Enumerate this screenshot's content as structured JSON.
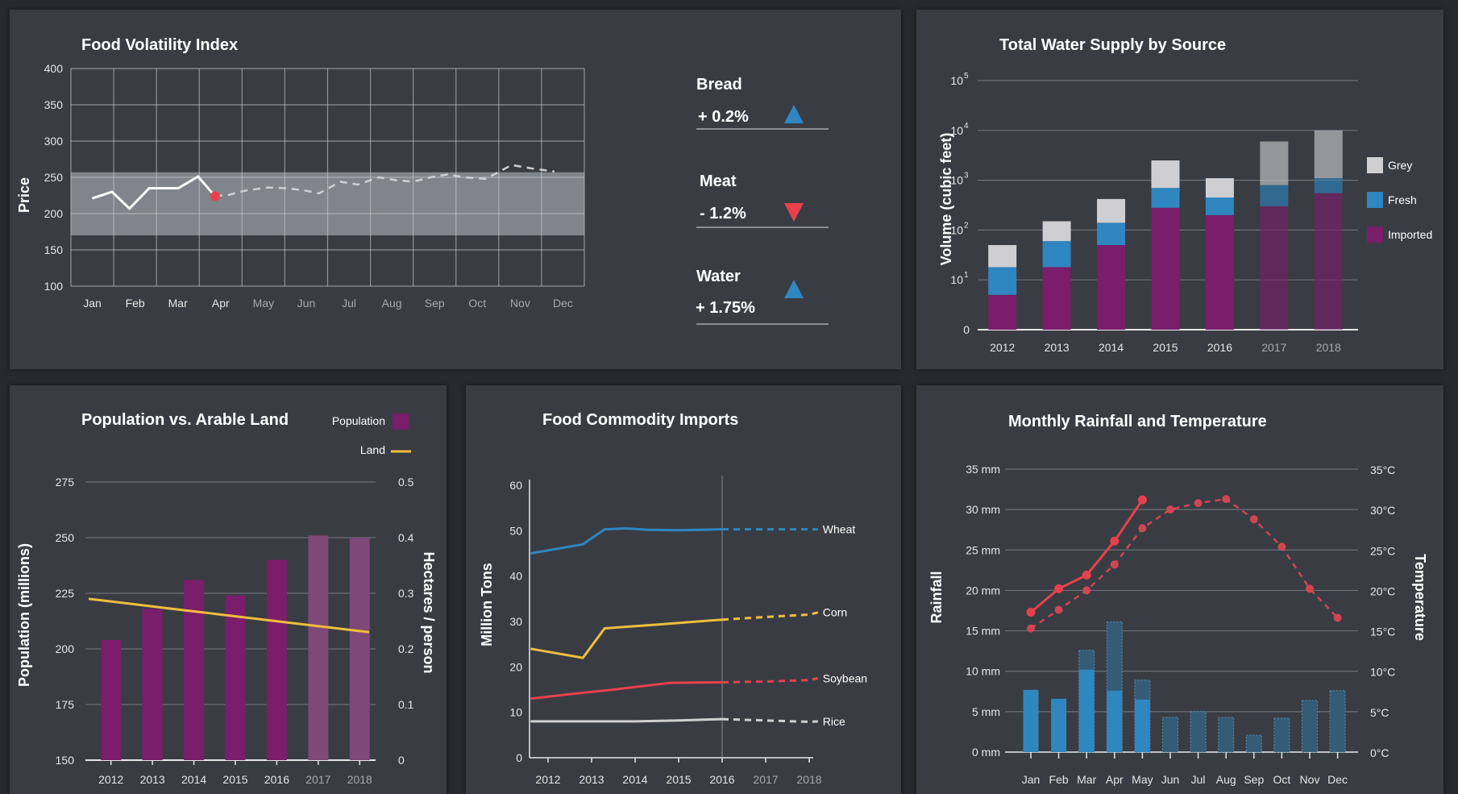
{
  "colors": {
    "grid": "#6d7076",
    "purple": "#7a1d6b",
    "purple_dim": "#7e4877",
    "blue": "#2f86c1",
    "grey_bar": "#cfcfd1",
    "band": "#8d9099",
    "red": "#e8414c",
    "red_dots": "#cf4652",
    "yellow": "#f0bd3f",
    "line_white": "#ffffff",
    "line_grey": "#d0d0d0",
    "rain_bar": "#2f87bf",
    "rain_bar_proj": "#355c75"
  },
  "kpis": [
    {
      "name": "Bread",
      "value": "+ 0.2%",
      "trend": "up",
      "trend_color": "#2f86c1"
    },
    {
      "name": "Meat",
      "value": "- 1.2%",
      "trend": "down",
      "trend_color": "#e8414c"
    },
    {
      "name": "Water",
      "value": "+ 1.75%",
      "trend": "up",
      "trend_color": "#2f86c1"
    }
  ],
  "chart_data": [
    {
      "id": "food",
      "type": "line",
      "title": "Food Volatility Index",
      "ylabel": "Price",
      "xlabel": "",
      "ylim": [
        100,
        400
      ],
      "yticks": [
        100,
        150,
        200,
        250,
        300,
        350,
        400
      ],
      "categories": [
        "Jan",
        "Feb",
        "Mar",
        "Apr",
        "May",
        "Jun",
        "Jul",
        "Aug",
        "Sep",
        "Oct",
        "Nov",
        "Dec"
      ],
      "band": [
        170,
        257
      ],
      "series": [
        {
          "kind": "actual",
          "x": [
            0.5,
            0.96,
            1.37,
            1.83,
            2.51,
            2.97,
            3.37
          ],
          "y": [
            221,
            230,
            207,
            235,
            235,
            251,
            224
          ]
        },
        {
          "kind": "forecast",
          "x": [
            3.37,
            3.7,
            4.1,
            4.6,
            5.05,
            5.45,
            5.8,
            6.3,
            6.7,
            7.2,
            7.6,
            8.0,
            8.4,
            8.8,
            9.2,
            9.7,
            10.3,
            10.8,
            11.3
          ],
          "y": [
            224,
            226,
            232,
            236,
            235,
            232,
            228,
            244,
            240,
            250,
            246,
            244,
            250,
            254,
            250,
            248,
            267,
            262,
            258
          ]
        }
      ],
      "marker": {
        "x": 3.37,
        "y": 224
      }
    },
    {
      "id": "water",
      "type": "bar",
      "title": "Total Water Supply by Source",
      "ylabel": "Volume (cubic feet)",
      "xlabel": "",
      "scale": "log",
      "yticks": [
        {
          "label": "0",
          "exp": null
        },
        {
          "label": "10",
          "exp": "1"
        },
        {
          "label": "10",
          "exp": "2"
        },
        {
          "label": "10",
          "exp": "3"
        },
        {
          "label": "10",
          "exp": "4"
        },
        {
          "label": "10",
          "exp": "5"
        }
      ],
      "categories": [
        "2012",
        "2013",
        "2014",
        "2015",
        "2016",
        "2017",
        "2018"
      ],
      "projected_from": 5,
      "series": [
        {
          "name": "Imported",
          "values": [
            5,
            18,
            50,
            280,
            200,
            300,
            550
          ]
        },
        {
          "name": "Fresh",
          "values": [
            18,
            60,
            140,
            700,
            450,
            800,
            1100
          ]
        },
        {
          "name": "Grey",
          "values": [
            50,
            150,
            420,
            2500,
            1100,
            6000,
            10000
          ]
        }
      ],
      "legend": [
        "Grey",
        "Fresh",
        "Imported"
      ]
    },
    {
      "id": "pop",
      "type": "bar",
      "title": "Population vs. Arable Land",
      "ylabel": "Population (millions)",
      "y2label": "Hectares / person",
      "ylim": [
        150,
        275
      ],
      "yticks": [
        150,
        175,
        200,
        225,
        250,
        275
      ],
      "y2lim": [
        0,
        0.5
      ],
      "y2ticks": [
        "0",
        "0.1",
        "0.2",
        "0.3",
        "0.4",
        "0.5"
      ],
      "categories": [
        "2012",
        "2013",
        "2014",
        "2015",
        "2016",
        "2017",
        "2018"
      ],
      "projected_from": 5,
      "series": [
        {
          "name": "Population",
          "values": [
            204,
            218,
            231,
            224,
            240,
            251,
            250
          ]
        },
        {
          "name": "Land",
          "values": [
            0.29,
            0.28,
            0.27,
            0.26,
            0.25,
            0.24,
            0.23
          ]
        }
      ],
      "legend": [
        "Population",
        "Land"
      ]
    },
    {
      "id": "imports",
      "type": "line",
      "title": "Food Commodity Imports",
      "ylabel": "Million Tons",
      "ylim": [
        0,
        60
      ],
      "yticks": [
        0,
        10,
        20,
        30,
        40,
        50,
        60
      ],
      "categories": [
        "2012",
        "2013",
        "2014",
        "2015",
        "2016",
        "2017",
        "2018"
      ],
      "series": [
        {
          "name": "Wheat",
          "x": [
            -0.4,
            0.2,
            0.8,
            1.3,
            1.8,
            2.3,
            3,
            3.5,
            4,
            4.5,
            5,
            5.5,
            6,
            6.2
          ],
          "y": [
            45,
            46,
            47,
            50.3,
            50.5,
            50.2,
            50.1,
            50.2,
            50.3,
            50.3,
            50.3,
            50.3,
            50.3,
            50.3
          ],
          "split": 4
        },
        {
          "name": "Corn",
          "x": [
            -0.4,
            0.8,
            1.3,
            2.5,
            4,
            5,
            6,
            6.2
          ],
          "y": [
            24,
            22,
            28.5,
            29.3,
            30.4,
            31,
            31.5,
            32
          ],
          "split": 4
        },
        {
          "name": "Soybean",
          "x": [
            -0.4,
            0.5,
            1.5,
            2.8,
            4,
            5,
            6,
            6.2
          ],
          "y": [
            13,
            14,
            15,
            16.5,
            16.6,
            16.8,
            17.1,
            17.5
          ],
          "split": 4
        },
        {
          "name": "Rice",
          "x": [
            -0.4,
            1,
            2,
            3,
            4,
            5,
            6,
            6.2
          ],
          "y": [
            8,
            8,
            8,
            8.2,
            8.5,
            8.2,
            7.9,
            8
          ],
          "split": 4
        }
      ]
    },
    {
      "id": "rain",
      "type": "bar",
      "title": "Monthly Rainfall and Temperature",
      "ylabel": "Rainfall",
      "y2label": "Temperature",
      "ylim": [
        0,
        35
      ],
      "yticks": [
        "0 mm",
        "5 mm",
        "10 mm",
        "15 mm",
        "20 mm",
        "25 mm",
        "30 mm",
        "35 mm"
      ],
      "y2ticks": [
        "0°C",
        "5°C",
        "10°C",
        "15°C",
        "20°C",
        "25°C",
        "30°C",
        "35°C"
      ],
      "categories": [
        "Jan",
        "Feb",
        "Mar",
        "Apr",
        "May",
        "Jun",
        "Jul",
        "Aug",
        "Sep",
        "Oct",
        "Nov",
        "Dec"
      ],
      "projected_from": 5,
      "series": [
        {
          "name": "Rainfall",
          "values": [
            7.7,
            6.6,
            10.2,
            7.6,
            6.5,
            4.3,
            5.0,
            4.3,
            2.1,
            4.2,
            6.4,
            7.6
          ]
        },
        {
          "name": "Rainfall (high)",
          "values": [
            null,
            null,
            12.6,
            16.1,
            8.9,
            null,
            null,
            null,
            null,
            null,
            null,
            null
          ]
        },
        {
          "name": "Temperature",
          "values": [
            17.3,
            20.2,
            21.9,
            26.1,
            31.2,
            null,
            null,
            null,
            null,
            null,
            null,
            null
          ]
        },
        {
          "name": "Temperature (dashed)",
          "values": [
            15.3,
            17.6,
            20.0,
            23.2,
            27.7,
            30.0,
            30.8,
            31.3,
            28.8,
            25.4,
            20.2,
            16.6
          ]
        }
      ]
    }
  ]
}
